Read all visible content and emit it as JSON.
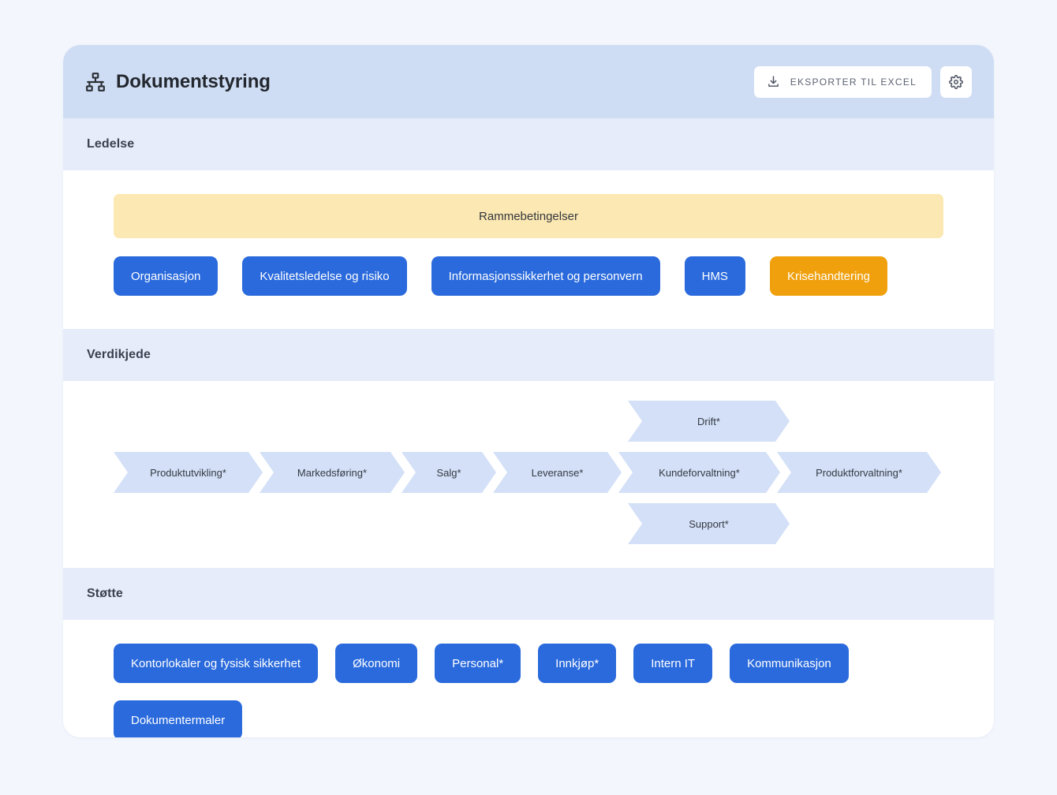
{
  "header": {
    "title": "Dokumentstyring",
    "icon": "sitemap-icon",
    "export_label": "EKSPORTER TIL EXCEL",
    "export_icon": "download-icon",
    "settings_icon": "gear-icon"
  },
  "colors": {
    "page_background": "#f3f6fd",
    "header_band": "#cfddf4",
    "section_band": "#e6ecfa",
    "pill_blue": "#2a6adc",
    "pill_orange": "#f0a00d",
    "banner_amber": "#fce8b2",
    "chevron_blue": "#d3e0f7"
  },
  "sections": [
    {
      "id": "ledelse",
      "label": "Ledelse",
      "banner": {
        "label": "Rammebetingelser",
        "color": "#fce8b2"
      },
      "items": [
        {
          "label": "Organisasjon",
          "color": "blue"
        },
        {
          "label": "Kvalitetsledelse og risiko",
          "color": "blue"
        },
        {
          "label": "Informasjonssikkerhet og personvern",
          "color": "blue"
        },
        {
          "label": "HMS",
          "color": "blue"
        },
        {
          "label": "Krisehandtering",
          "color": "orange"
        }
      ]
    },
    {
      "id": "verdikjede",
      "label": "Verdikjede",
      "top_branch": {
        "label": "Drift*"
      },
      "bottom_branch": {
        "label": "Support*"
      },
      "chain": [
        {
          "label": "Produktutvikling*"
        },
        {
          "label": "Markedsføring*"
        },
        {
          "label": "Salg*"
        },
        {
          "label": "Leveranse*"
        },
        {
          "label": "Kundeforvaltning*"
        },
        {
          "label": "Produktforvaltning*"
        }
      ]
    },
    {
      "id": "stotte",
      "label": "Støtte",
      "items": [
        {
          "label": "Kontorlokaler og fysisk sikkerhet",
          "color": "blue"
        },
        {
          "label": "Økonomi",
          "color": "blue"
        },
        {
          "label": "Personal*",
          "color": "blue"
        },
        {
          "label": "Innkjøp*",
          "color": "blue"
        },
        {
          "label": "Intern IT",
          "color": "blue"
        },
        {
          "label": "Kommunikasjon",
          "color": "blue"
        },
        {
          "label": "Dokumentermaler",
          "color": "blue"
        }
      ]
    }
  ]
}
